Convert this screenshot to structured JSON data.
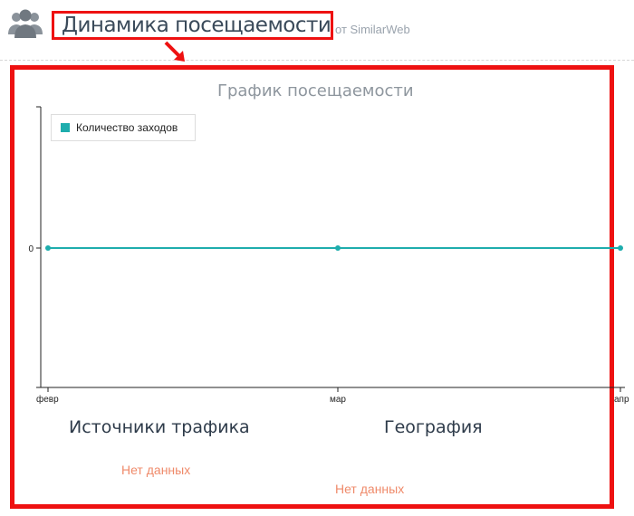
{
  "header": {
    "title": "Динамика посещаемости",
    "source_suffix": "от SimilarWeb",
    "icon": "users-icon"
  },
  "chart_data": {
    "type": "line",
    "title": "График посещаемости",
    "x": [
      "февр",
      "мар",
      "апр"
    ],
    "series": [
      {
        "name": "Количество заходов",
        "values": [
          0,
          0,
          0
        ]
      }
    ],
    "ytick_labels": [
      "0"
    ],
    "legend": "top-left",
    "grid": false
  },
  "sections": {
    "traffic_sources": {
      "title": "Источники трафика",
      "nodata": "Нет данных"
    },
    "geography": {
      "title": "География",
      "nodata": "Нет данных"
    }
  },
  "colors": {
    "series": "#1eadad",
    "highlight": "#ee1111",
    "nodata": "#ef8a6a"
  }
}
